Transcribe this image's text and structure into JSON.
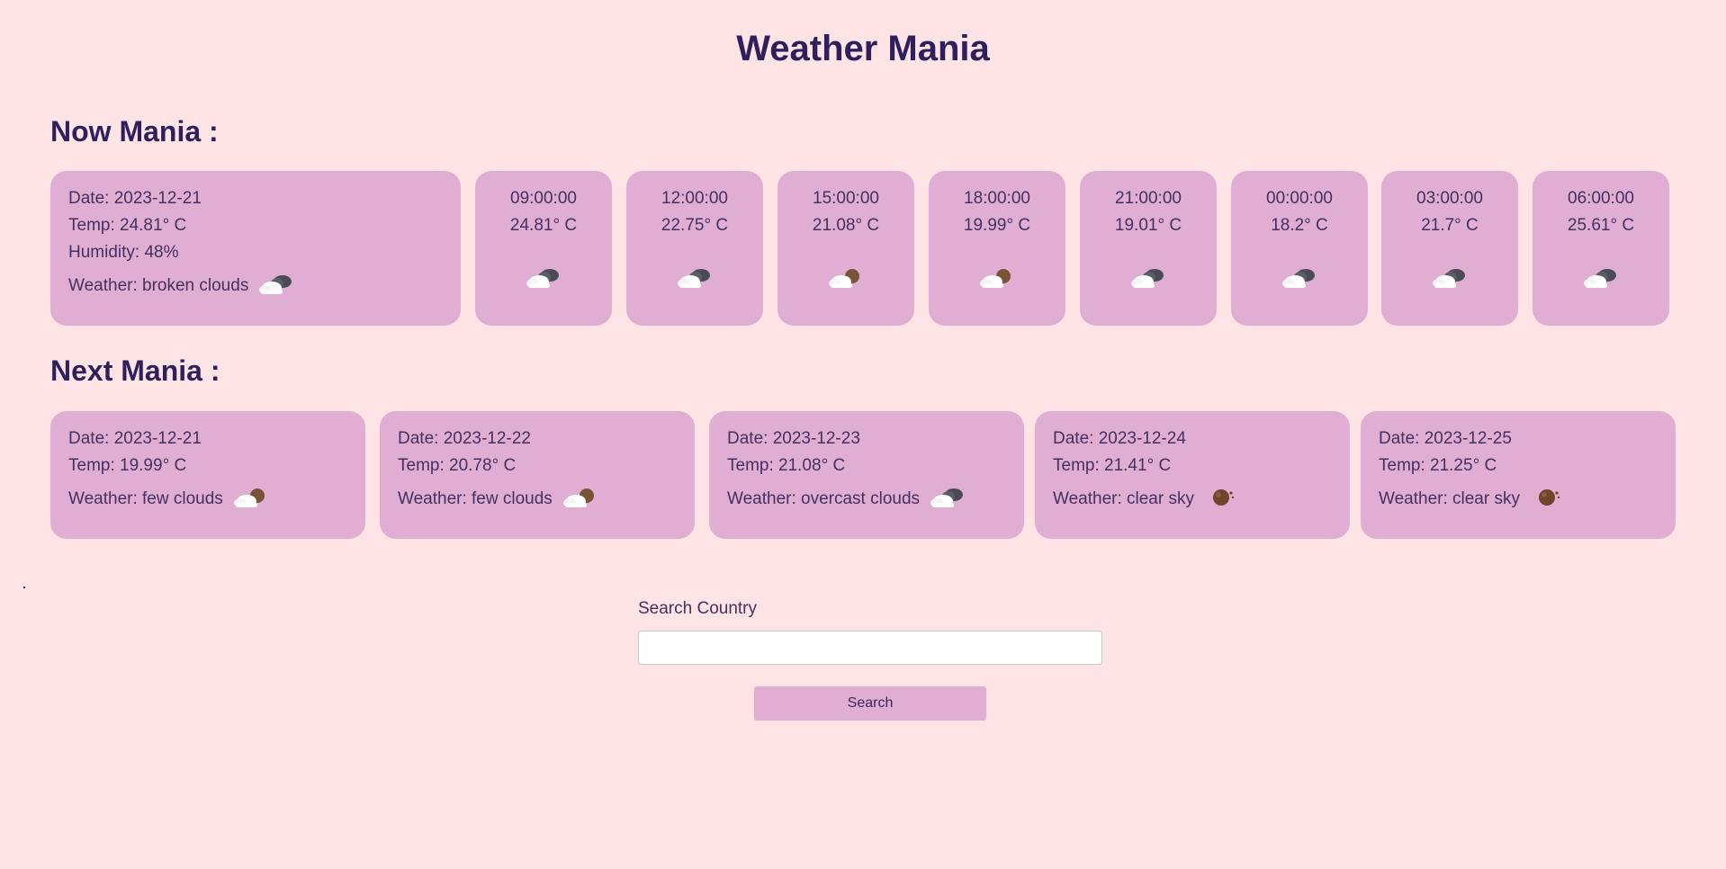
{
  "app": {
    "title": "Weather Mania"
  },
  "now": {
    "heading": "Now Mania :",
    "current": {
      "date": "Date: 2023-12-21",
      "temp": "Temp: 24.81° C",
      "humidity": "Humidity: 48%",
      "weather": "Weather: broken clouds",
      "icon": "broken-clouds-icon"
    },
    "hourly": [
      {
        "time": "09:00:00",
        "temp": "24.81° C",
        "icon": "broken-clouds-icon"
      },
      {
        "time": "12:00:00",
        "temp": "22.75° C",
        "icon": "broken-clouds-icon"
      },
      {
        "time": "15:00:00",
        "temp": "21.08° C",
        "icon": "few-clouds-icon"
      },
      {
        "time": "18:00:00",
        "temp": "19.99° C",
        "icon": "few-clouds-icon"
      },
      {
        "time": "21:00:00",
        "temp": "19.01° C",
        "icon": "broken-clouds-icon"
      },
      {
        "time": "00:00:00",
        "temp": "18.2° C",
        "icon": "broken-clouds-icon"
      },
      {
        "time": "03:00:00",
        "temp": "21.7° C",
        "icon": "broken-clouds-icon"
      },
      {
        "time": "06:00:00",
        "temp": "25.61° C",
        "icon": "broken-clouds-icon"
      }
    ]
  },
  "next": {
    "heading": "Next Mania :",
    "days": [
      {
        "date": "Date: 2023-12-21",
        "temp": "Temp: 19.99° C",
        "weather": "Weather: few clouds",
        "icon": "few-clouds-icon"
      },
      {
        "date": "Date: 2023-12-22",
        "temp": "Temp: 20.78° C",
        "weather": "Weather: few clouds",
        "icon": "few-clouds-icon"
      },
      {
        "date": "Date: 2023-12-23",
        "temp": "Temp: 21.08° C",
        "weather": "Weather: overcast clouds",
        "icon": "broken-clouds-icon"
      },
      {
        "date": "Date: 2023-12-24",
        "temp": "Temp: 21.41° C",
        "weather": "Weather: clear sky",
        "icon": "clear-sky-icon"
      },
      {
        "date": "Date: 2023-12-25",
        "temp": "Temp: 21.25° C",
        "weather": "Weather: clear sky",
        "icon": "clear-sky-icon"
      }
    ]
  },
  "search": {
    "label": "Search Country",
    "value": "",
    "placeholder": "",
    "button_label": "Search"
  },
  "colors": {
    "background": "#ffe4e6",
    "card": "#dfaed2",
    "heading": "#2f1f5c",
    "text": "#45305f"
  }
}
